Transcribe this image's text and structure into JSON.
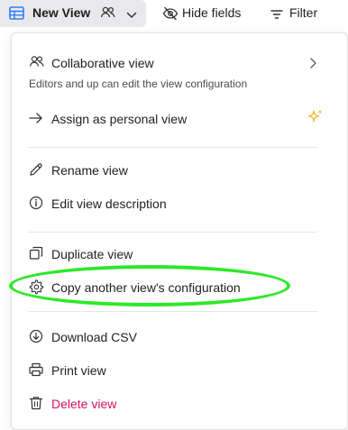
{
  "toolbar": {
    "view_name": "New View",
    "hide_fields_label": "Hide fields",
    "filter_label": "Filter"
  },
  "menu": {
    "collaborative": {
      "label": "Collaborative view",
      "description": "Editors and up can edit the view configuration"
    },
    "assign_personal_label": "Assign as personal view",
    "rename_label": "Rename view",
    "edit_description_label": "Edit view description",
    "duplicate_label": "Duplicate view",
    "copy_config_label": "Copy another view's configuration",
    "download_csv_label": "Download CSV",
    "print_label": "Print view",
    "delete_label": "Delete view"
  },
  "colors": {
    "danger": "#d6125c",
    "sparkle": "#f0b429",
    "highlight": "#2ee82a",
    "grid_icon": "#2d7ff9"
  },
  "icons": {
    "grid": "grid-view-icon",
    "collaborators": "people-icon",
    "chevron_down": "chevron-down-icon",
    "hide": "eye-slash-icon",
    "filter": "filter-icon",
    "submenu": "chevron-right-icon",
    "assign": "arrow-right-icon",
    "sparkle": "sparkle-icon",
    "rename": "pencil-icon",
    "info": "info-icon",
    "duplicate": "copy-icon",
    "gear": "gear-icon",
    "download": "download-icon",
    "print": "printer-icon",
    "trash": "trash-icon"
  }
}
